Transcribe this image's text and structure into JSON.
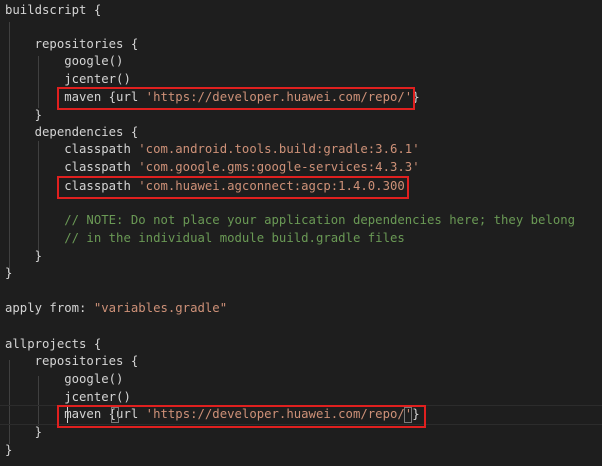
{
  "editor": {
    "lines": [
      {
        "id": "L1",
        "segments": [
          {
            "t": "buildscript {",
            "c": ""
          }
        ]
      },
      {
        "id": "L2",
        "segments": []
      },
      {
        "id": "L3",
        "segments": [
          {
            "t": "    repositories {",
            "c": ""
          }
        ]
      },
      {
        "id": "L4",
        "segments": [
          {
            "t": "        google()",
            "c": ""
          }
        ]
      },
      {
        "id": "L5",
        "segments": [
          {
            "t": "        jcenter()",
            "c": ""
          }
        ]
      },
      {
        "id": "L6",
        "segments": [
          {
            "t": "        maven {url ",
            "c": ""
          },
          {
            "t": "'https://developer.huawei.com/repo/'",
            "c": "str"
          },
          {
            "t": "}",
            "c": ""
          }
        ]
      },
      {
        "id": "L7",
        "segments": [
          {
            "t": "    }",
            "c": ""
          }
        ]
      },
      {
        "id": "L8",
        "segments": [
          {
            "t": "    dependencies {",
            "c": ""
          }
        ]
      },
      {
        "id": "L9",
        "segments": [
          {
            "t": "        classpath ",
            "c": ""
          },
          {
            "t": "'com.android.tools.build:gradle:3.6.1'",
            "c": "str"
          }
        ]
      },
      {
        "id": "L10",
        "segments": [
          {
            "t": "        classpath ",
            "c": ""
          },
          {
            "t": "'com.google.gms:google-services:4.3.3'",
            "c": "str"
          }
        ]
      },
      {
        "id": "L11",
        "segments": [
          {
            "t": "        classpath ",
            "c": ""
          },
          {
            "t": "'com.huawei.agconnect:agcp:1.4.0.300'",
            "c": "str"
          }
        ]
      },
      {
        "id": "L12",
        "segments": []
      },
      {
        "id": "L13",
        "segments": [
          {
            "t": "        // NOTE: Do not place your application dependencies here; they belong",
            "c": "cmt"
          }
        ]
      },
      {
        "id": "L14",
        "segments": [
          {
            "t": "        // in the individual module build.gradle files",
            "c": "cmt"
          }
        ]
      },
      {
        "id": "L15",
        "segments": [
          {
            "t": "    }",
            "c": ""
          }
        ]
      },
      {
        "id": "L16",
        "segments": [
          {
            "t": "}",
            "c": ""
          }
        ]
      },
      {
        "id": "L17",
        "segments": []
      },
      {
        "id": "L18",
        "segments": [
          {
            "t": "apply from: ",
            "c": ""
          },
          {
            "t": "\"variables.gradle\"",
            "c": "str"
          }
        ]
      },
      {
        "id": "L19",
        "segments": []
      },
      {
        "id": "L20",
        "segments": [
          {
            "t": "allprojects {",
            "c": ""
          }
        ]
      },
      {
        "id": "L21",
        "segments": [
          {
            "t": "    repositories {",
            "c": ""
          }
        ]
      },
      {
        "id": "L22",
        "segments": [
          {
            "t": "        google()",
            "c": ""
          }
        ]
      },
      {
        "id": "L23",
        "segments": [
          {
            "t": "        jcenter()",
            "c": ""
          }
        ]
      },
      {
        "id": "L24",
        "segments": [
          {
            "t": "        maven {url ",
            "c": ""
          },
          {
            "t": "'https://developer.huawei.com/repo/'",
            "c": "str"
          },
          {
            "t": "}",
            "c": ""
          }
        ]
      },
      {
        "id": "L25",
        "segments": [
          {
            "t": "    }",
            "c": ""
          }
        ]
      },
      {
        "id": "L26",
        "segments": [
          {
            "t": "}",
            "c": ""
          }
        ]
      }
    ],
    "highlighted_lines": [
      "L6",
      "L11",
      "L24"
    ],
    "active_line": "L24"
  },
  "colors": {
    "background": "#1e1e1e",
    "text": "#d4d4d4",
    "string": "#ce9178",
    "comment": "#6a9955",
    "highlight_box": "#e0201f"
  }
}
